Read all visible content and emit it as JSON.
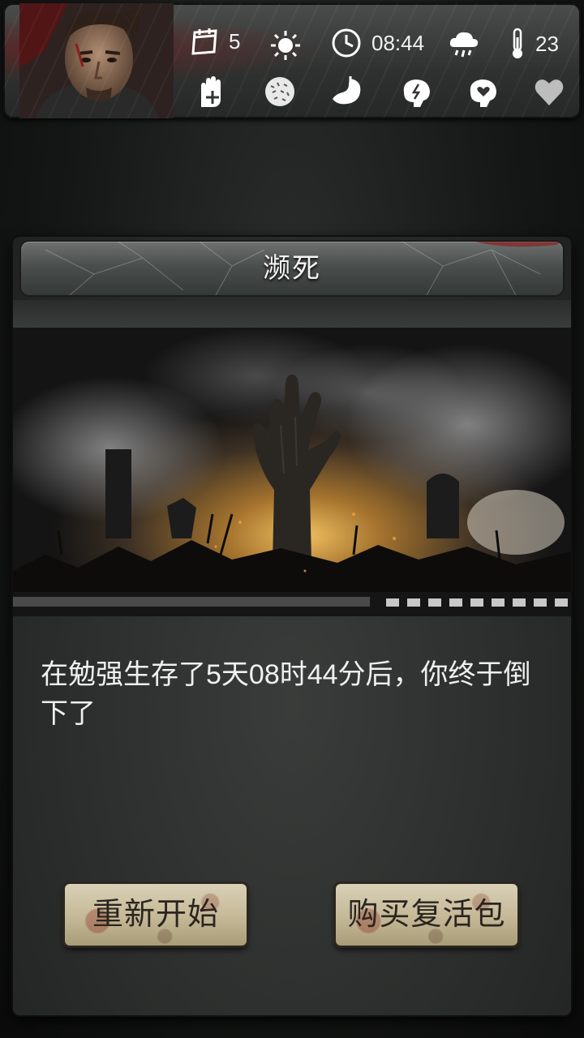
{
  "hud": {
    "days": "5",
    "time": "08:44",
    "temperature": "23",
    "weather_icon": "rain-cloud-icon",
    "daylight_icon": "sun-icon",
    "status_icons": [
      "hand-plus-icon",
      "stomach-texture-icon",
      "stomach-icon",
      "brain-energy-icon",
      "brain-heart-icon",
      "heart-icon"
    ]
  },
  "dialog": {
    "title": "濒死",
    "message": "在勉强生存了5天08时44分后，你终于倒下了",
    "restart_label": "重新开始",
    "revive_label": "购买复活包"
  },
  "colors": {
    "button_face": "#c4b896",
    "hud_background": "#3a3c3b",
    "text": "#f0f0f0"
  }
}
